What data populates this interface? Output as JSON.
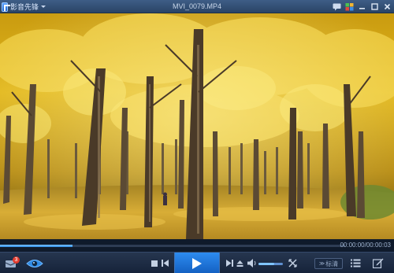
{
  "app": {
    "name": "影音先锋",
    "file_title": "MVI_0079.MP4"
  },
  "player": {
    "progress_fraction": 0.21,
    "elapsed": "00:00:00",
    "duration": "00:00:03",
    "time_separator": "/",
    "volume_fraction": 0.65,
    "notification_count": "3",
    "quality_label": "标清",
    "quality_arrows": "≫"
  },
  "icons": {
    "logo": "app-logo-icon",
    "chat": "chat-icon",
    "skin": "skin-icon",
    "minimize": "minimize-icon",
    "maximize": "maximize-icon",
    "close": "close-icon"
  },
  "colors": {
    "accent": "#2b8be8",
    "play_button": "#1f7ae0",
    "titlebar": "#34527a",
    "badge": "#e33b2e"
  }
}
